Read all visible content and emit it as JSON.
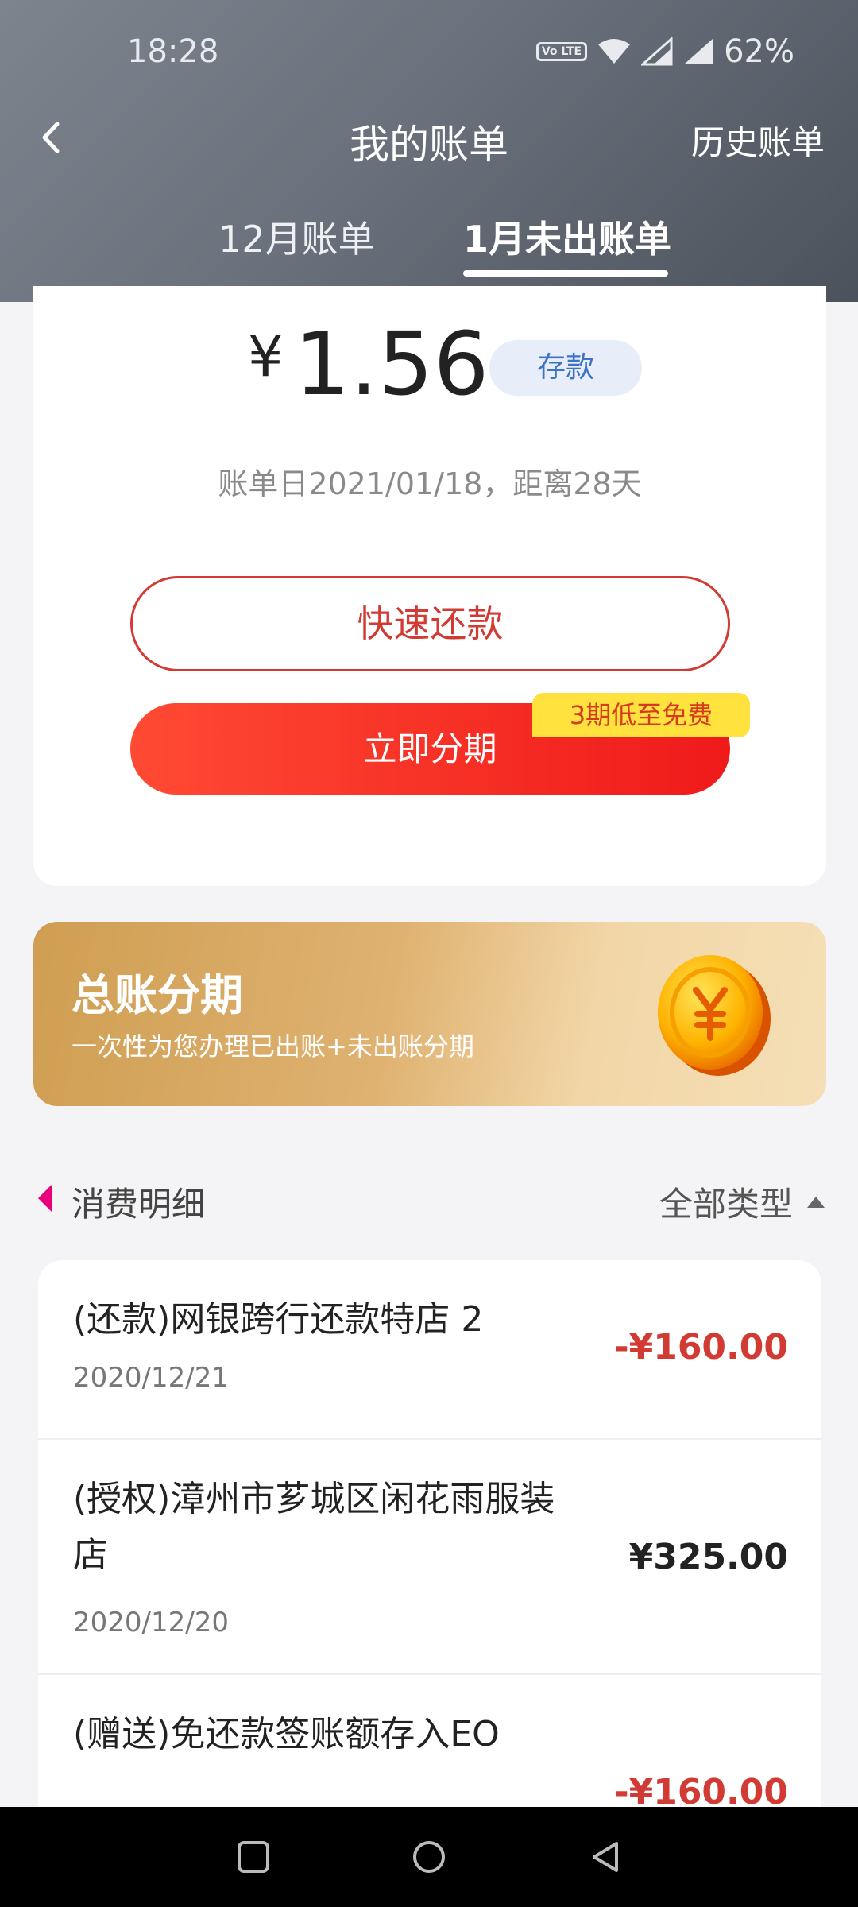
{
  "status_bar": {
    "time": "18:28",
    "volte_label": "Vo LTE",
    "battery": "62%"
  },
  "nav": {
    "title": "我的账单",
    "history": "历史账单",
    "back_icon": "chevron-left-icon"
  },
  "tabs": [
    {
      "label": "12月账单",
      "active": false
    },
    {
      "label": "1月未出账单",
      "active": true
    }
  ],
  "summary": {
    "currency_symbol": "¥",
    "amount": "1.56",
    "badge": "存款",
    "bill_date_text": "账单日2021/01/18，距离28天"
  },
  "actions": {
    "quick_repay": "快速还款",
    "installment": "立即分期",
    "promo_tag": "3期低至免费"
  },
  "banner": {
    "title": "总账分期",
    "subtitle": "一次性为您办理已出账+未出账分期",
    "icon": "coin-icon"
  },
  "details": {
    "title": "消费明细",
    "filter": "全部类型"
  },
  "transactions": [
    {
      "title": "(还款)网银跨行还款特店 2",
      "date": "2020/12/21",
      "amount": "-¥160.00"
    },
    {
      "title": "(授权)漳州市芗城区闲花雨服装店",
      "date": "2020/12/20",
      "amount": "¥325.00"
    },
    {
      "title": "(赠送)免还款签账额存入EO",
      "date": "",
      "amount": "-¥160.00"
    }
  ],
  "colors": {
    "accent_red": "#d23b33",
    "badge_blue": "#3d73c7",
    "promo_yellow": "#ffe23d",
    "banner_gold": "#dfb271"
  }
}
